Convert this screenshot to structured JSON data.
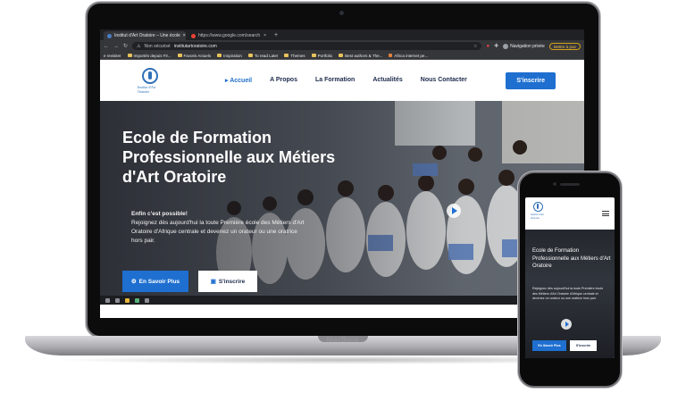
{
  "browser": {
    "tabs": [
      {
        "label": "Institut d'Art Oratoire – Une école",
        "active": true
      },
      {
        "label": "https://www.google.com/search",
        "active": false
      }
    ],
    "new_tab": "+",
    "nav": {
      "back": "←",
      "forward": "→",
      "reload": "↻"
    },
    "address": {
      "security": "Non sécurisé",
      "url": "institutartoratoire.com"
    },
    "profile_label": "Navigation privée",
    "update_label": "Mettre à jour",
    "bookmarks": [
      "e revisiter",
      "Importés depuis Fir...",
      "Favoris Actuels",
      "Inspiration",
      "To read Later",
      "Themes",
      "Portfolio",
      "Best authors & The...",
      "Africa internet pe..."
    ]
  },
  "site": {
    "logo_text": "Institut d'Art Oratoire",
    "menu": [
      {
        "label": "Accueil",
        "active": true
      },
      {
        "label": "A Propos",
        "active": false
      },
      {
        "label": "La Formation",
        "active": false
      },
      {
        "label": "Actualités",
        "active": false
      },
      {
        "label": "Nous Contacter",
        "active": false
      }
    ],
    "cta": "S'inscrire",
    "hero": {
      "title": "Ecole de Formation Professionnelle aux Métiers d'Art Oratoire",
      "lead_bold": "Enfin c'est possible!",
      "lead": "Rejoignez dès aujourd'hui la toute Première école des Métiers d'Art Oratoire d'Afrique centrale et devenez un orateur ou une oratrice hors pair.",
      "btn_primary": "En Savoir Plus",
      "btn_secondary": "S'inscrire"
    }
  },
  "device_label": "MacBook",
  "phone": {
    "title": "Ecole de Formation Professionnelle aux Métiers d'Art Oratoire",
    "lead": "Rejoignez dès aujourd'hui la toute Première école des Métiers d'Art Oratoire d'Afrique centrale et devenez un orateur ou une oratrice hors pair.",
    "btn_primary": "En Savoir Plus",
    "btn_secondary": "S'inscrire"
  },
  "colors": {
    "accent": "#1e6fd0",
    "nav_text": "#1b2a4a",
    "chrome_dark": "#202124"
  }
}
